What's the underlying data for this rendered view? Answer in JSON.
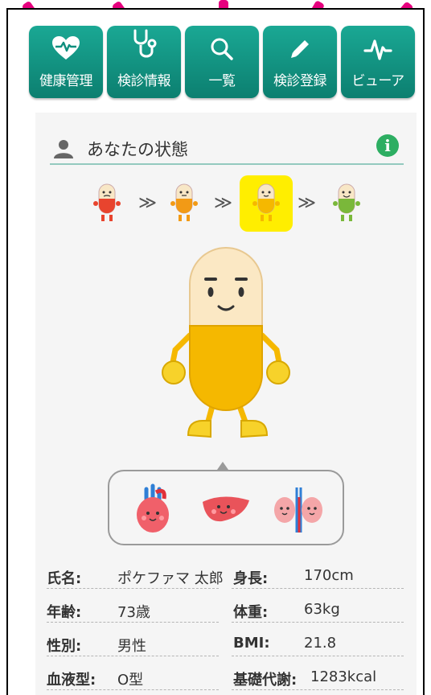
{
  "nav": [
    {
      "id": "health",
      "label": "健康管理",
      "icon": "heart-pulse-icon"
    },
    {
      "id": "checkup-info",
      "label": "検診情報",
      "icon": "stethoscope-icon"
    },
    {
      "id": "list",
      "label": "一覧",
      "icon": "search-icon"
    },
    {
      "id": "checkup-register",
      "label": "検診登録",
      "icon": "pencil-icon"
    },
    {
      "id": "viewer",
      "label": "ビューア",
      "icon": "pulse-icon"
    }
  ],
  "status": {
    "title": "あなたの状態",
    "info_glyph": "i",
    "stage_colors": [
      "#e8442e",
      "#f29a16",
      "#f5b800",
      "#7ab83a"
    ],
    "selected_stage": 3,
    "separator": "≫"
  },
  "profile": {
    "name_label": "氏名:",
    "name": "ポケファマ 太郎",
    "height_label": "身長:",
    "height": "170cm",
    "age_label": "年齢:",
    "age": "73歳",
    "weight_label": "体重:",
    "weight": "63kg",
    "sex_label": "性別:",
    "sex": "男性",
    "bmi_label": "BMI:",
    "bmi": "21.8",
    "blood_label": "血液型:",
    "blood": "O型",
    "bmr_label": "基礎代謝:",
    "bmr": "1283kcal"
  },
  "colors": {
    "accent_teal": "#0f8f7e",
    "annotation_pink": "#e6007e",
    "info_green": "#2dae62",
    "selected_highlight": "#ffee00",
    "hero_yellow": "#f5b800"
  }
}
